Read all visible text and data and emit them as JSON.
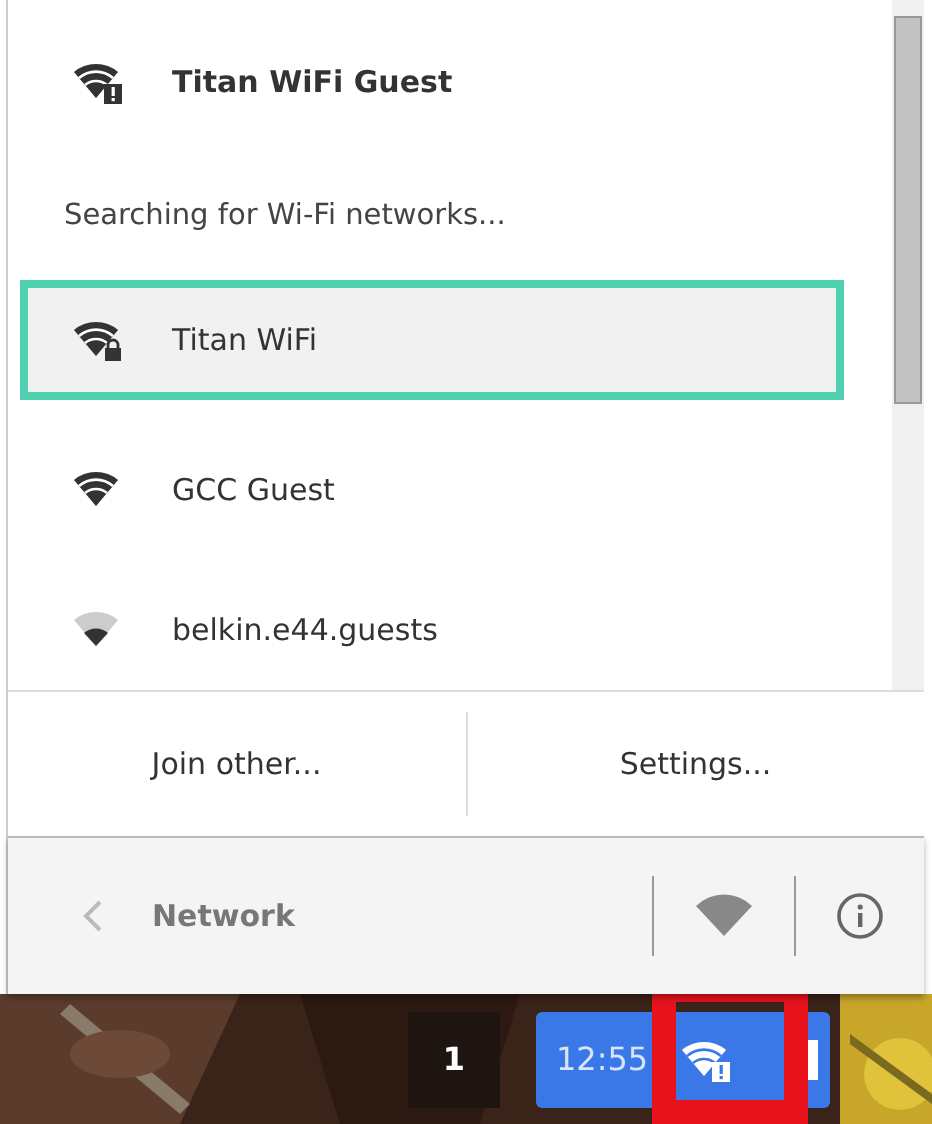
{
  "connected": {
    "name": "Titan WiFi Guest",
    "kind": "warning"
  },
  "status": "Searching for Wi-Fi networks...",
  "networks": [
    {
      "name": "Titan WiFi",
      "kind": "locked",
      "selected": true
    },
    {
      "name": "GCC Guest",
      "kind": "open",
      "selected": false
    },
    {
      "name": "belkin.e44.guests",
      "kind": "weak",
      "selected": false
    }
  ],
  "buttons": [
    "Join other...",
    "Settings..."
  ],
  "footer": {
    "title": "Network"
  },
  "shelf": {
    "count": "1",
    "time": "12:55",
    "highlighted": true
  }
}
